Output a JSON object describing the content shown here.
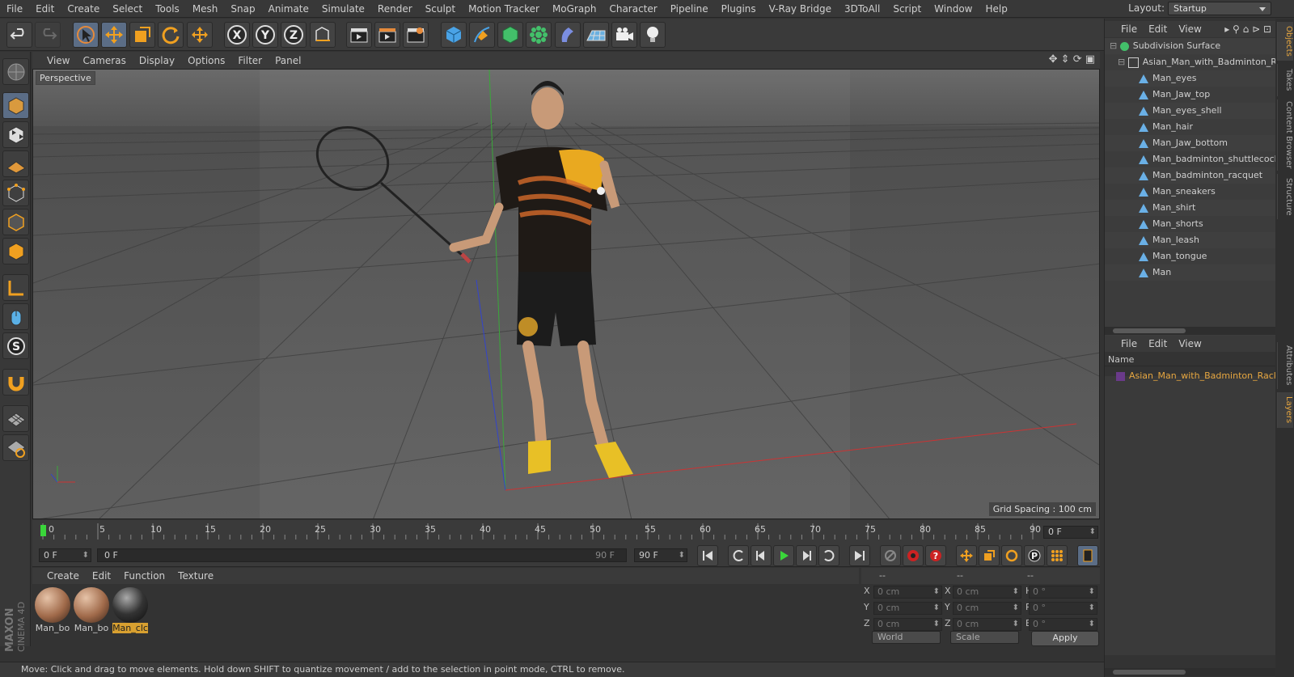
{
  "menubar": {
    "items": [
      "File",
      "Edit",
      "Create",
      "Select",
      "Tools",
      "Mesh",
      "Snap",
      "Animate",
      "Simulate",
      "Render",
      "Sculpt",
      "Motion Tracker",
      "MoGraph",
      "Character",
      "Pipeline",
      "Plugins",
      "V-Ray Bridge",
      "3DToAll",
      "Script",
      "Window",
      "Help"
    ],
    "layout_label": "Layout:",
    "layout_value": "Startup"
  },
  "toolbar": {
    "axis_x": "X",
    "axis_y": "Y",
    "axis_z": "Z"
  },
  "viewport": {
    "menu": [
      "View",
      "Cameras",
      "Display",
      "Options",
      "Filter",
      "Panel"
    ],
    "camera_label": "Perspective",
    "grid_spacing": "Grid Spacing : 100 cm"
  },
  "timeline": {
    "ticks": [
      "0",
      "5",
      "10",
      "15",
      "20",
      "25",
      "30",
      "35",
      "40",
      "45",
      "50",
      "55",
      "60",
      "65",
      "70",
      "75",
      "80",
      "85",
      "90"
    ],
    "current_frame_right": "0 F",
    "start_field": "0 F",
    "range_start": "0 F",
    "range_end": "90 F",
    "end_field": "90 F"
  },
  "materials": {
    "menu": [
      "Create",
      "Edit",
      "Function",
      "Texture"
    ],
    "items": [
      {
        "label": "Man_bo"
      },
      {
        "label": "Man_bo"
      },
      {
        "label": "Man_clc"
      }
    ]
  },
  "coordinates": {
    "head_1": "--",
    "head_2": "--",
    "head_3": "--",
    "rows": [
      {
        "a": "X",
        "av": "0 cm",
        "b": "X",
        "bv": "0 cm",
        "c": "H",
        "cv": "0 °"
      },
      {
        "a": "Y",
        "av": "0 cm",
        "b": "Y",
        "bv": "0 cm",
        "c": "P",
        "cv": "0 °"
      },
      {
        "a": "Z",
        "av": "0 cm",
        "b": "Z",
        "bv": "0 cm",
        "c": "B",
        "cv": "0 °"
      }
    ],
    "space": "World",
    "mode": "Scale",
    "apply": "Apply"
  },
  "status": "Move: Click and drag to move elements. Hold down SHIFT to quantize movement / add to the selection in point mode, CTRL to remove.",
  "objects": {
    "menu": [
      "File",
      "Edit",
      "View"
    ],
    "items": [
      "Subdivision Surface",
      "Asian_Man_with_Badminton_Racket",
      "Man_eyes",
      "Man_Jaw_top",
      "Man_eyes_shell",
      "Man_hair",
      "Man_Jaw_bottom",
      "Man_badminton_shuttlecock",
      "Man_badminton_racquet",
      "Man_sneakers",
      "Man_shirt",
      "Man_shorts",
      "Man_leash",
      "Man_tongue",
      "Man"
    ]
  },
  "layers": {
    "menu": [
      "File",
      "Edit",
      "View"
    ],
    "column": "Name",
    "item": "Asian_Man_with_Badminton_Racket"
  },
  "side_tabs": [
    "Objects",
    "Takes",
    "Content Browser",
    "Structure",
    "Attributes",
    "Layers"
  ],
  "brand": "MAXON CINEMA 4D",
  "colors": {
    "accent": "#e6a640",
    "selection": "#5b6d86"
  }
}
